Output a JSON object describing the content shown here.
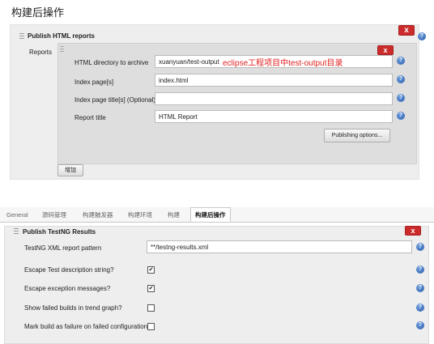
{
  "top": {
    "page_title": "构建后操作",
    "section_title": "Publish HTML reports",
    "reports_label": "Reports",
    "close_symbol": "x",
    "help_symbol": "?",
    "fields": [
      {
        "label": "HTML directory to archive",
        "value": "xuanyuan/test-output"
      },
      {
        "label": "Index page[s]",
        "value": "index.html"
      },
      {
        "label": "Index page title[s] (Optional)",
        "value": ""
      },
      {
        "label": "Report title",
        "value": "HTML Report"
      }
    ],
    "annotation": "eclipse工程项目中test-output目录",
    "annotation_color": "#e02020",
    "publishing_options_button": "Publishing options...",
    "add_button": "增加"
  },
  "tabs": {
    "items": [
      "General",
      "源码管理",
      "构建触发器",
      "构建环境",
      "构建",
      "构建后操作"
    ],
    "active_index": 5
  },
  "bottom": {
    "section_title": "Publish TestNG Results",
    "close_symbol": "x",
    "help_symbol": "?",
    "pattern_label": "TestNG XML report pattern",
    "pattern_value": "**/testng-results.xml",
    "options": [
      {
        "label": "Escape Test description string?",
        "checked": true
      },
      {
        "label": "Escape exception messages?",
        "checked": true
      },
      {
        "label": "Show failed builds in trend graph?",
        "checked": false
      },
      {
        "label": "Mark build as failure on failed configuration?",
        "checked": false
      }
    ],
    "check_mark": "✔"
  },
  "colors": {
    "close_button": "#cc2b2b",
    "help_icon": "#2b5fae",
    "panel_bg": "#eeeeee",
    "reports_bg": "#dedede"
  }
}
